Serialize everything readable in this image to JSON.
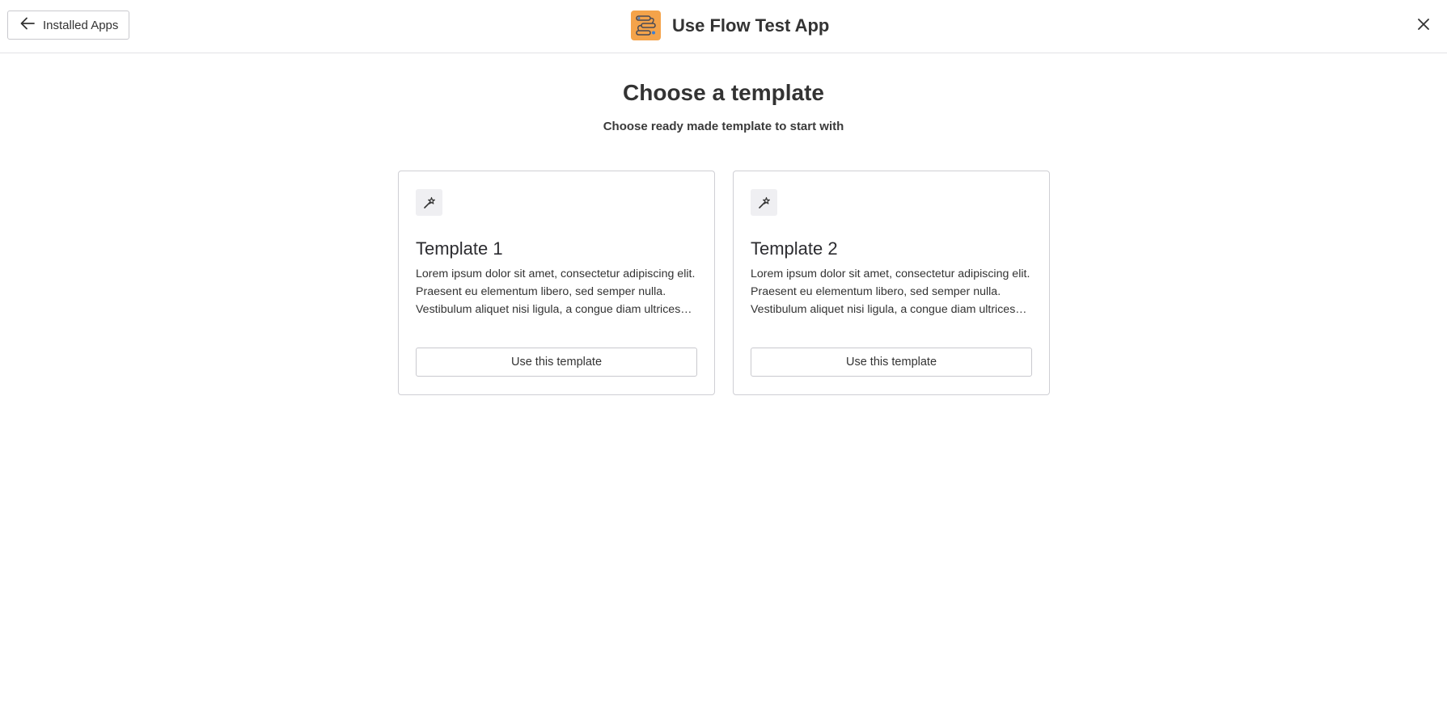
{
  "header": {
    "back_label": "Installed Apps",
    "app_title": "Use Flow Test App",
    "logo_color": "#f4a34a",
    "icons": {
      "back": "arrow-left-icon",
      "logo": "flow-icon",
      "close": "close-icon"
    }
  },
  "main": {
    "heading": "Choose a template",
    "subheading": "Choose ready made template to start with"
  },
  "templates": [
    {
      "icon": "magic-wand-icon",
      "title": "Template 1",
      "description": "Lorem ipsum dolor sit amet, consectetur adipiscing elit. Praesent eu elementum libero, sed semper nulla. Vestibulum aliquet nisi ligula, a congue diam ultrices vitae.",
      "button_label": "Use this template"
    },
    {
      "icon": "magic-wand-icon",
      "title": "Template 2",
      "description": "Lorem ipsum dolor sit amet, consectetur adipiscing elit. Praesent eu elementum libero, sed semper nulla. Vestibulum aliquet nisi ligula, a congue diam ultrices vitae.",
      "button_label": "Use this template"
    }
  ]
}
